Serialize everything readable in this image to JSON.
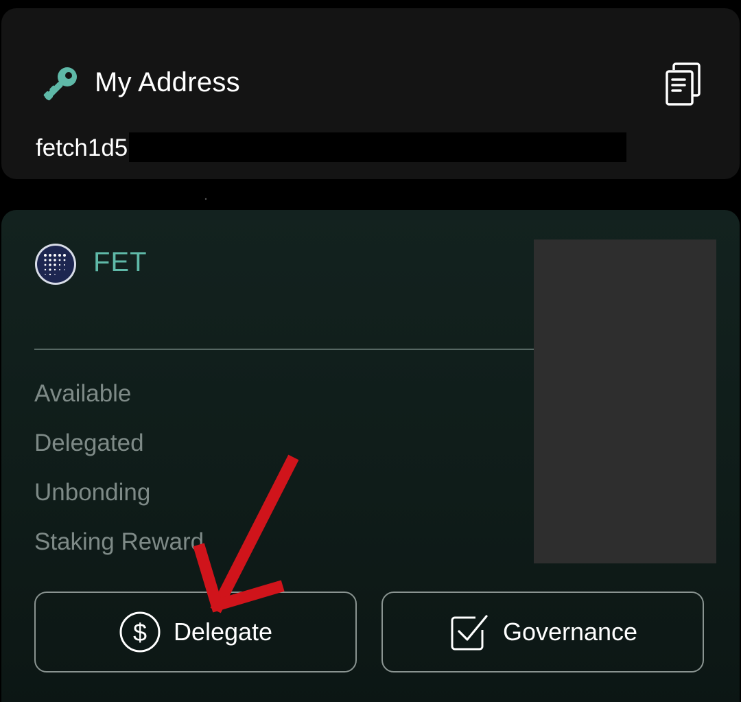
{
  "address_card": {
    "title": "My Address",
    "address_prefix": "fetch1d5",
    "key_icon": "key-icon",
    "copy_icon": "copy-icon"
  },
  "token_card": {
    "logo_icon": "fetch-ai-logo",
    "symbol": "FET",
    "labels": {
      "available": "Available",
      "delegated": "Delegated",
      "unbonding": "Unbonding",
      "staking_reward": "Staking Reward"
    },
    "actions": {
      "delegate": {
        "label": "Delegate",
        "icon": "dollar-circle-icon"
      },
      "governance": {
        "label": "Governance",
        "icon": "checkbox-icon"
      }
    }
  },
  "colors": {
    "accent": "#5fb9a8",
    "annotation_arrow": "#d0141b",
    "card_bg": "#141414",
    "token_card_bg": "#13221f"
  }
}
